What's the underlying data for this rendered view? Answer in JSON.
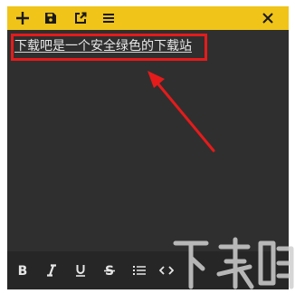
{
  "colors": {
    "titlebar": "#f0c419",
    "editor_bg": "#2f2f2f",
    "annotation": "#e51b1b"
  },
  "toolbar": {
    "icons": [
      "plus-icon",
      "save-icon",
      "external-link-icon",
      "menu-icon",
      "close-icon"
    ]
  },
  "note": {
    "text": "下载吧是一个安全绿色的下载站"
  },
  "format_bar": {
    "icons": [
      "bold-icon",
      "italic-icon",
      "underline-icon",
      "strikethrough-icon",
      "bulleted-list-icon",
      "code-icon"
    ]
  },
  "watermark": {
    "text": "下载吧"
  }
}
